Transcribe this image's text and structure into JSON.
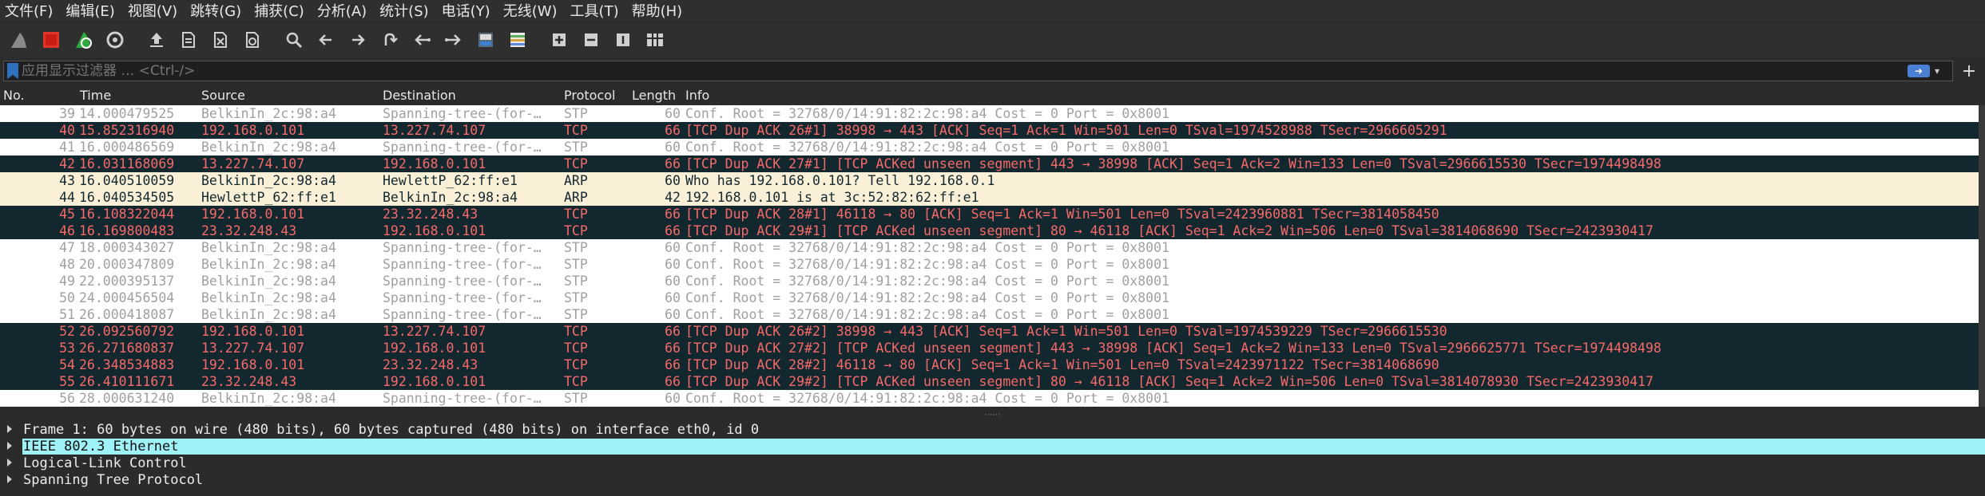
{
  "menu": [
    "文件(F)",
    "编辑(E)",
    "视图(V)",
    "跳转(G)",
    "捕获(C)",
    "分析(A)",
    "统计(S)",
    "电话(Y)",
    "无线(W)",
    "工具(T)",
    "帮助(H)"
  ],
  "toolbar": {
    "icons": [
      "shark-fin-icon",
      "stop-capture-icon",
      "restart-capture-icon",
      "capture-options-icon",
      "open-file-icon",
      "save-file-icon",
      "close-file-icon",
      "reload-file-icon",
      "find-packet-icon",
      "go-back-icon",
      "go-forward-icon",
      "go-to-packet-icon",
      "go-first-icon",
      "go-last-icon",
      "autoscroll-icon",
      "colorize-icon",
      "zoom-in-icon",
      "zoom-out-icon",
      "zoom-normal-icon",
      "resize-columns-icon"
    ]
  },
  "filter": {
    "placeholder": "应用显示过滤器 … <Ctrl-/>"
  },
  "columns": {
    "no": "No.",
    "time": "Time",
    "source": "Source",
    "destination": "Destination",
    "protocol": "Protocol",
    "length": "Length",
    "info": "Info"
  },
  "packets": [
    {
      "no": "39",
      "time": "14.000479525",
      "src": "BelkinIn_2c:98:a4",
      "dst": "Spanning-tree-(for-…",
      "proto": "STP",
      "len": "60",
      "info": "Conf. Root = 32768/0/14:91:82:2c:98:a4  Cost = 0  Port = 0x8001",
      "kind": "stp"
    },
    {
      "no": "40",
      "time": "15.852316940",
      "src": "192.168.0.101",
      "dst": "13.227.74.107",
      "proto": "TCP",
      "len": "66",
      "info": "[TCP Dup ACK 26#1] 38998 → 443 [ACK] Seq=1 Ack=1 Win=501 Len=0 TSval=1974528988 TSecr=2966605291",
      "kind": "tcp"
    },
    {
      "no": "41",
      "time": "16.000486569",
      "src": "BelkinIn_2c:98:a4",
      "dst": "Spanning-tree-(for-…",
      "proto": "STP",
      "len": "60",
      "info": "Conf. Root = 32768/0/14:91:82:2c:98:a4  Cost = 0  Port = 0x8001",
      "kind": "stp"
    },
    {
      "no": "42",
      "time": "16.031168069",
      "src": "13.227.74.107",
      "dst": "192.168.0.101",
      "proto": "TCP",
      "len": "66",
      "info": "[TCP Dup ACK 27#1] [TCP ACKed unseen segment] 443 → 38998 [ACK] Seq=1 Ack=2 Win=133 Len=0 TSval=2966615530 TSecr=1974498498",
      "kind": "tcp"
    },
    {
      "no": "43",
      "time": "16.040510059",
      "src": "BelkinIn_2c:98:a4",
      "dst": "HewlettP_62:ff:e1",
      "proto": "ARP",
      "len": "60",
      "info": "Who has 192.168.0.101? Tell 192.168.0.1",
      "kind": "arp"
    },
    {
      "no": "44",
      "time": "16.040534505",
      "src": "HewlettP_62:ff:e1",
      "dst": "BelkinIn_2c:98:a4",
      "proto": "ARP",
      "len": "42",
      "info": "192.168.0.101 is at 3c:52:82:62:ff:e1",
      "kind": "arp"
    },
    {
      "no": "45",
      "time": "16.108322044",
      "src": "192.168.0.101",
      "dst": "23.32.248.43",
      "proto": "TCP",
      "len": "66",
      "info": "[TCP Dup ACK 28#1] 46118 → 80 [ACK] Seq=1 Ack=1 Win=501 Len=0 TSval=2423960881 TSecr=3814058450",
      "kind": "tcp"
    },
    {
      "no": "46",
      "time": "16.169800483",
      "src": "23.32.248.43",
      "dst": "192.168.0.101",
      "proto": "TCP",
      "len": "66",
      "info": "[TCP Dup ACK 29#1] [TCP ACKed unseen segment] 80 → 46118 [ACK] Seq=1 Ack=2 Win=506 Len=0 TSval=3814068690 TSecr=2423930417",
      "kind": "tcp"
    },
    {
      "no": "47",
      "time": "18.000343027",
      "src": "BelkinIn_2c:98:a4",
      "dst": "Spanning-tree-(for-…",
      "proto": "STP",
      "len": "60",
      "info": "Conf. Root = 32768/0/14:91:82:2c:98:a4  Cost = 0  Port = 0x8001",
      "kind": "stp"
    },
    {
      "no": "48",
      "time": "20.000347809",
      "src": "BelkinIn_2c:98:a4",
      "dst": "Spanning-tree-(for-…",
      "proto": "STP",
      "len": "60",
      "info": "Conf. Root = 32768/0/14:91:82:2c:98:a4  Cost = 0  Port = 0x8001",
      "kind": "stp"
    },
    {
      "no": "49",
      "time": "22.000395137",
      "src": "BelkinIn_2c:98:a4",
      "dst": "Spanning-tree-(for-…",
      "proto": "STP",
      "len": "60",
      "info": "Conf. Root = 32768/0/14:91:82:2c:98:a4  Cost = 0  Port = 0x8001",
      "kind": "stp"
    },
    {
      "no": "50",
      "time": "24.000456504",
      "src": "BelkinIn_2c:98:a4",
      "dst": "Spanning-tree-(for-…",
      "proto": "STP",
      "len": "60",
      "info": "Conf. Root = 32768/0/14:91:82:2c:98:a4  Cost = 0  Port = 0x8001",
      "kind": "stp"
    },
    {
      "no": "51",
      "time": "26.000418087",
      "src": "BelkinIn_2c:98:a4",
      "dst": "Spanning-tree-(for-…",
      "proto": "STP",
      "len": "60",
      "info": "Conf. Root = 32768/0/14:91:82:2c:98:a4  Cost = 0  Port = 0x8001",
      "kind": "stp"
    },
    {
      "no": "52",
      "time": "26.092560792",
      "src": "192.168.0.101",
      "dst": "13.227.74.107",
      "proto": "TCP",
      "len": "66",
      "info": "[TCP Dup ACK 26#2] 38998 → 443 [ACK] Seq=1 Ack=1 Win=501 Len=0 TSval=1974539229 TSecr=2966615530",
      "kind": "tcp"
    },
    {
      "no": "53",
      "time": "26.271680837",
      "src": "13.227.74.107",
      "dst": "192.168.0.101",
      "proto": "TCP",
      "len": "66",
      "info": "[TCP Dup ACK 27#2] [TCP ACKed unseen segment] 443 → 38998 [ACK] Seq=1 Ack=2 Win=133 Len=0 TSval=2966625771 TSecr=1974498498",
      "kind": "tcp"
    },
    {
      "no": "54",
      "time": "26.348534883",
      "src": "192.168.0.101",
      "dst": "23.32.248.43",
      "proto": "TCP",
      "len": "66",
      "info": "[TCP Dup ACK 28#2] 46118 → 80 [ACK] Seq=1 Ack=1 Win=501 Len=0 TSval=2423971122 TSecr=3814068690",
      "kind": "tcp"
    },
    {
      "no": "55",
      "time": "26.410111671",
      "src": "23.32.248.43",
      "dst": "192.168.0.101",
      "proto": "TCP",
      "len": "66",
      "info": "[TCP Dup ACK 29#2] [TCP ACKed unseen segment] 80 → 46118 [ACK] Seq=1 Ack=2 Win=506 Len=0 TSval=3814078930 TSecr=2423930417",
      "kind": "tcp"
    },
    {
      "no": "56",
      "time": "28.000631240",
      "src": "BelkinIn_2c:98:a4",
      "dst": "Spanning-tree-(for-…",
      "proto": "STP",
      "len": "60",
      "info": "Conf. Root = 32768/0/14:91:82:2c:98:a4  Cost = 0  Port = 0x8001",
      "kind": "stp"
    }
  ],
  "details": [
    {
      "text": "Frame 1: 60 bytes on wire (480 bits), 60 bytes captured (480 bits) on interface eth0, id 0",
      "selected": false
    },
    {
      "text": "IEEE 802.3 Ethernet",
      "selected": true
    },
    {
      "text": "Logical-Link Control",
      "selected": false
    },
    {
      "text": "Spanning Tree Protocol",
      "selected": false
    }
  ],
  "colors": {
    "stp_bg": "#ffffff",
    "stp_fg": "#a0a0a0",
    "tcp_bg": "#12272e",
    "tcp_fg": "#f76a6a",
    "arp_bg": "#faf0d7",
    "arp_fg": "#12272e",
    "selected_detail_bg": "#9ff2f7"
  }
}
